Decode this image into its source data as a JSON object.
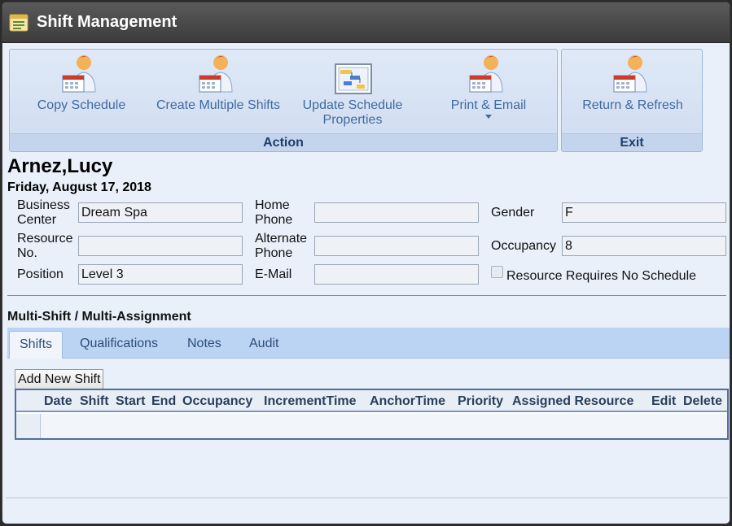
{
  "window": {
    "title": "Shift Management"
  },
  "ribbon": {
    "action_group_label": "Action",
    "exit_group_label": "Exit",
    "buttons": [
      {
        "label": "Copy Schedule",
        "icon": "person-calendar-icon"
      },
      {
        "label": "Create Multiple Shifts",
        "icon": "person-calendar-icon"
      },
      {
        "label_line1": "Update Schedule",
        "label_line2": "Properties",
        "icon": "schedule-properties-icon"
      },
      {
        "label": "Print & Email",
        "icon": "person-calendar-icon",
        "has_dropdown": true
      },
      {
        "label": "Return & Refresh",
        "icon": "person-calendar-icon"
      }
    ]
  },
  "resource": {
    "name": "Arnez,Lucy",
    "date": "Friday, August 17, 2018"
  },
  "fields": {
    "business_center": {
      "label_line1": "Business",
      "label_line2": "Center",
      "value": "Dream Spa"
    },
    "resource_no": {
      "label_line1": "Resource",
      "label_line2": "No.",
      "value": ""
    },
    "position": {
      "label": "Position",
      "value": "Level 3"
    },
    "home_phone": {
      "label_line1": "Home",
      "label_line2": "Phone",
      "value": ""
    },
    "alternate_phone": {
      "label_line1": "Alternate",
      "label_line2": "Phone",
      "value": ""
    },
    "email": {
      "label": "E-Mail",
      "value": ""
    },
    "gender": {
      "label": "Gender",
      "value": "F"
    },
    "occupancy": {
      "label": "Occupancy",
      "value": "8"
    },
    "no_schedule": {
      "label": "Resource Requires No Schedule",
      "checked": false
    }
  },
  "multi_shift": {
    "title": "Multi-Shift / Multi-Assignment",
    "tabs": [
      {
        "label": "Shifts",
        "active": true
      },
      {
        "label": "Qualifications",
        "active": false
      },
      {
        "label": "Notes",
        "active": false
      },
      {
        "label": "Audit",
        "active": false
      }
    ],
    "add_button": "Add New Shift",
    "columns": [
      "Date",
      "Shift",
      "Start",
      "End",
      "Occupancy",
      "IncrementTime",
      "AnchorTime",
      "Priority",
      "Assigned Resource",
      "Edit",
      "Delete"
    ]
  },
  "colors": {
    "titlebar": "#4a4a4a",
    "ribbon_text": "#3f6aa0",
    "tabbar": "#bcd4f3",
    "background": "#e9f0fa"
  }
}
